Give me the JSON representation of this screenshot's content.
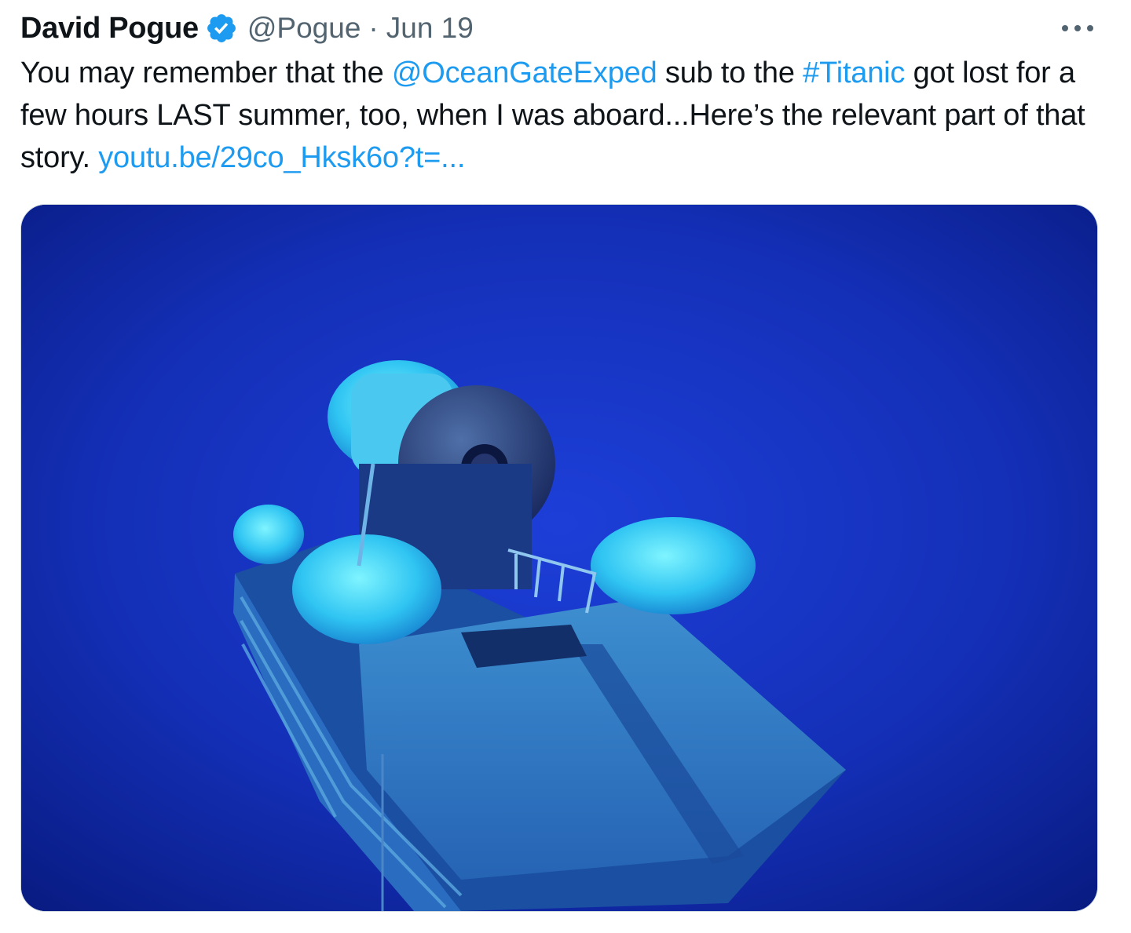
{
  "tweet": {
    "author": {
      "display_name": "David Pogue",
      "handle": "@Pogue",
      "verified": true
    },
    "separator": "·",
    "date": "Jun 19",
    "more_icon": "more-horizontal-icon",
    "text": {
      "t1": "You may remember that the ",
      "mention": "@OceanGateExped",
      "t2": " sub to the ",
      "hashtag": "#Titanic",
      "t3": " got lost for a few hours LAST summer, too, when I was aboard...Here’s the relevant part of that story. ",
      "url": "youtu.be/29co_Hksk6o?t=..."
    },
    "media": {
      "kind": "photo",
      "subject": "submersible"
    },
    "colors": {
      "link": "#1d9bf0",
      "verified_badge": "#1d9bf0",
      "secondary_text": "#536471"
    }
  }
}
